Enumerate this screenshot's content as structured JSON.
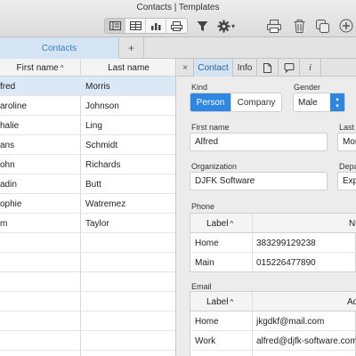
{
  "window": {
    "title": "Contacts | Templates"
  },
  "toolbar": {
    "view_icons": [
      "detail-view-icon",
      "table-view-icon",
      "chart-icon",
      "print-list-icon"
    ],
    "actions": [
      "filter-icon",
      "gear-icon",
      "print-icon",
      "trash-icon",
      "duplicate-icon",
      "add-icon"
    ],
    "gear_menu_glyph": "▾"
  },
  "tabs": {
    "contacts": "Contacts",
    "add": "+"
  },
  "list": {
    "columns": {
      "first_name": "First name",
      "last_name": "Last name",
      "sort_glyph": "^"
    },
    "rows": [
      {
        "first": "fred",
        "last": "Morris"
      },
      {
        "first": "aroline",
        "last": "Johnson"
      },
      {
        "first": "halie",
        "last": "Ling"
      },
      {
        "first": "ans",
        "last": "Schmidt"
      },
      {
        "first": "ohn",
        "last": "Richards"
      },
      {
        "first": "adin",
        "last": "Butt"
      },
      {
        "first": "ophie",
        "last": "Watremez"
      },
      {
        "first": "m",
        "last": "Taylor"
      }
    ]
  },
  "detail": {
    "tabs": {
      "close": "×",
      "contact": "Contact",
      "info": "Info",
      "italic": "i"
    },
    "kind": {
      "label": "Kind",
      "person": "Person",
      "company": "Company"
    },
    "gender": {
      "label": "Gender",
      "value": "Male"
    },
    "first_name": {
      "label": "First name",
      "value": "Alfred"
    },
    "last_name": {
      "label": "Last",
      "value": "Mor"
    },
    "organization": {
      "label": "Organization",
      "value": "DJFK Software"
    },
    "department": {
      "label": "Depa",
      "value": "Exp"
    },
    "phone": {
      "label": "Phone",
      "col_label": "Label",
      "col_number": "Nu",
      "sort_glyph": "^",
      "rows": [
        {
          "label": "Home",
          "value": "383299129238"
        },
        {
          "label": "Main",
          "value": "015226477890"
        }
      ]
    },
    "email": {
      "label": "Email",
      "col_label": "Label",
      "col_address": "Ad",
      "sort_glyph": "^",
      "rows": [
        {
          "label": "Home",
          "value": "jkgdkf@mail.com"
        },
        {
          "label": "Work",
          "value": "alfred@djfk-software.com"
        }
      ]
    }
  },
  "colors": {
    "accent": "#2f86e0",
    "selection": "#dbe8f5",
    "tab_active": "#d4e4f2"
  }
}
